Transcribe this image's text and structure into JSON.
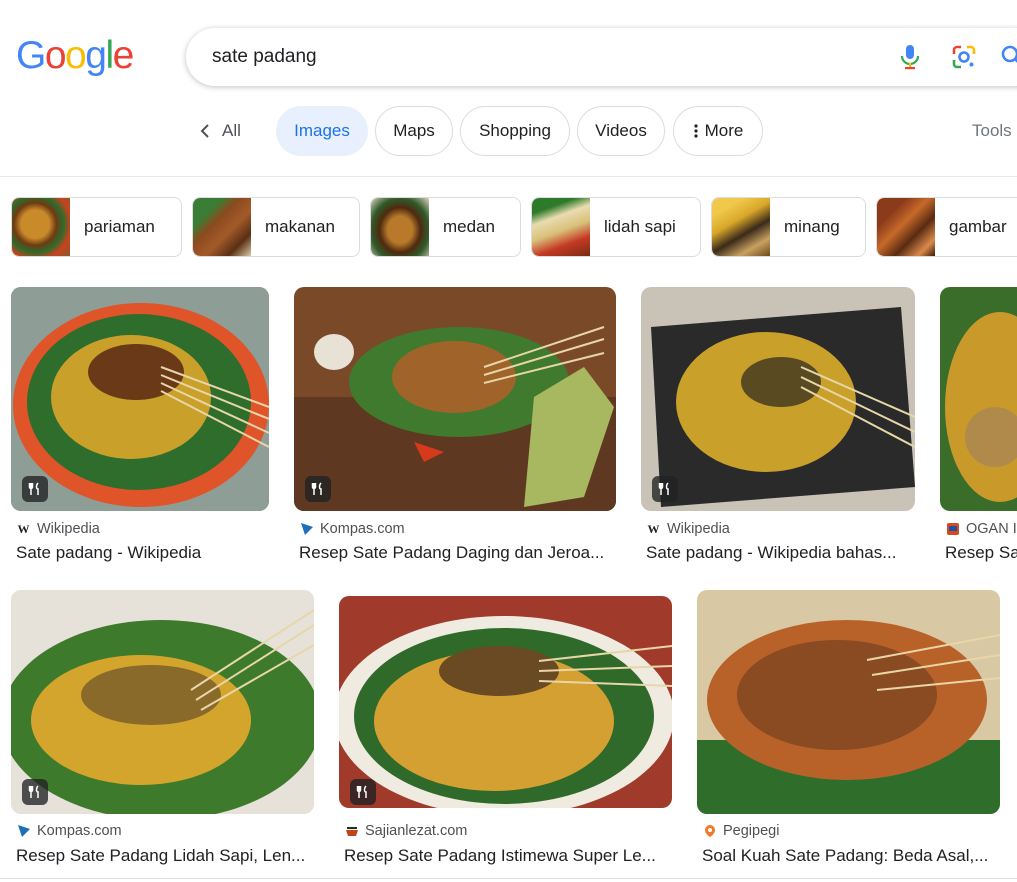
{
  "logo": {
    "letters": [
      "G",
      "o",
      "o",
      "g",
      "l",
      "e"
    ],
    "colors": [
      "#4285F4",
      "#EA4335",
      "#FBBC05",
      "#4285F4",
      "#34A853",
      "#EA4335"
    ]
  },
  "search": {
    "query": "sate padang",
    "mic_icon": "mic-icon",
    "lens_icon": "google-lens-icon",
    "search_icon": "search-icon"
  },
  "tabs": {
    "all_label": "All",
    "images_label": "Images",
    "maps_label": "Maps",
    "shopping_label": "Shopping",
    "videos_label": "Videos",
    "more_label": "More",
    "tools_label": "Tools",
    "active_color": "#1a73e8"
  },
  "refinements": [
    {
      "label": "pariaman"
    },
    {
      "label": "makanan"
    },
    {
      "label": "medan"
    },
    {
      "label": "lidah sapi"
    },
    {
      "label": "minang"
    },
    {
      "label": "gambar"
    }
  ],
  "results": [
    {
      "source": "Wikipedia",
      "title": "Sate padang - Wikipedia",
      "favicon": "wikipedia-icon"
    },
    {
      "source": "Kompas.com",
      "title": "Resep Sate Padang Daging dan Jeroa...",
      "favicon": "kompas-icon"
    },
    {
      "source": "Wikipedia",
      "title": "Sate padang - Wikipedia bahas...",
      "favicon": "wikipedia-icon"
    },
    {
      "source": "OGAN IL",
      "title": "Resep Sa",
      "favicon": "ogan-icon"
    },
    {
      "source": "Kompas.com",
      "title": "Resep Sate Padang Lidah Sapi, Len...",
      "favicon": "kompas-icon"
    },
    {
      "source": "Sajianlezat.com",
      "title": "Resep Sate Padang Istimewa Super Le...",
      "favicon": "sajianlezat-icon"
    },
    {
      "source": "Pegipegi",
      "title": "Soal Kuah Sate Padang: Beda Asal,...",
      "favicon": "pegipegi-icon"
    }
  ]
}
